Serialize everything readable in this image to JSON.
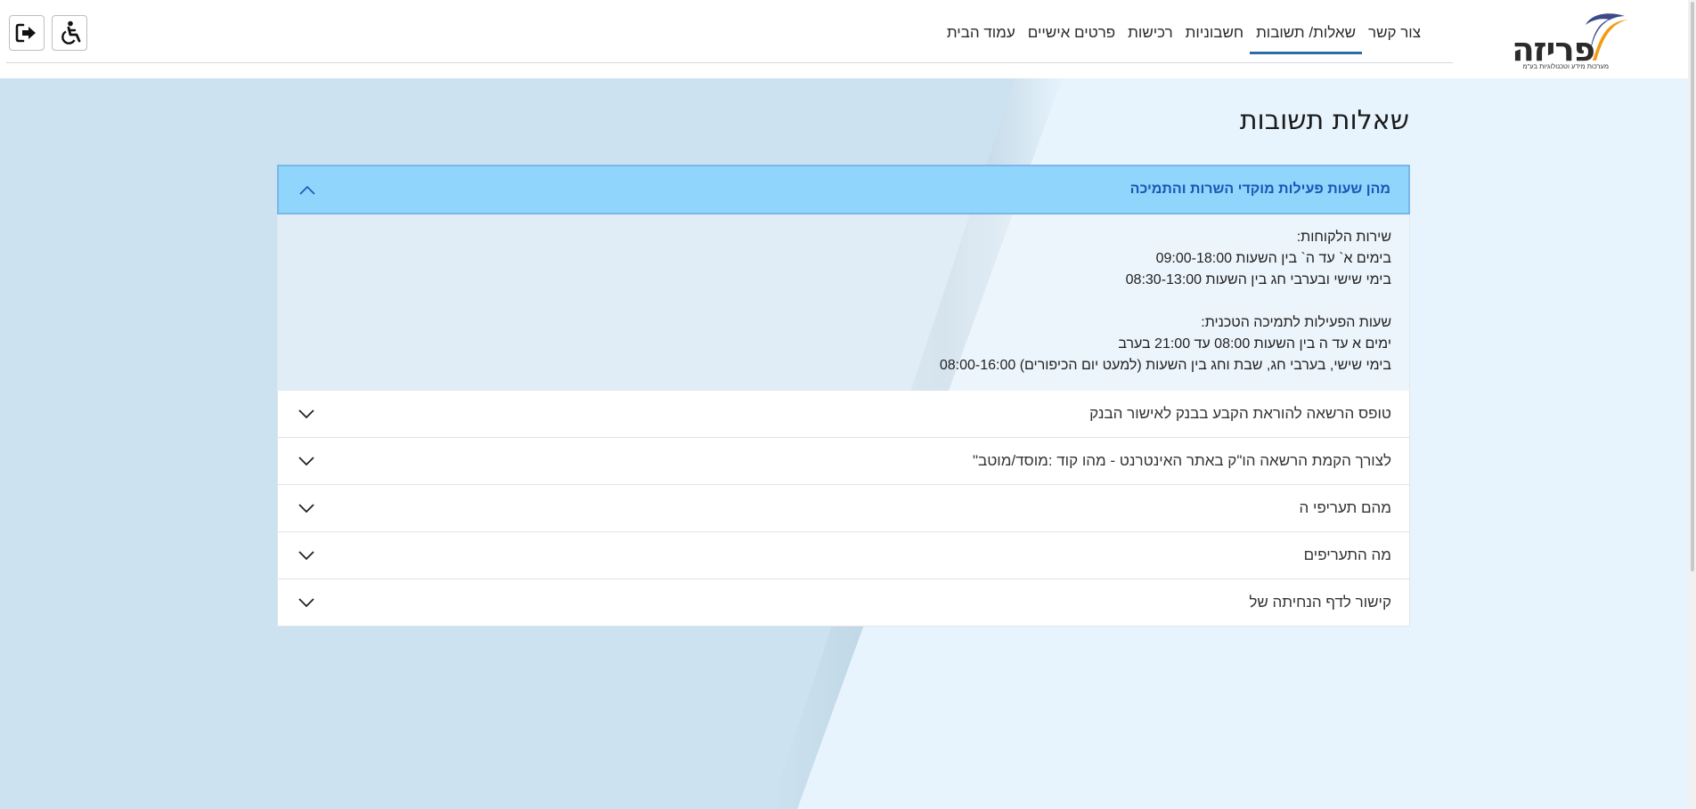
{
  "brand": {
    "name": "פריזה",
    "subtitle": "מערכות מידע וטכנולוגיות בע\"מ",
    "colors": {
      "orange": "#f39c12",
      "navy": "#3d4a8a"
    }
  },
  "header": {
    "nav": [
      {
        "label": "עמוד הבית",
        "active": false
      },
      {
        "label": "פרטים אישיים",
        "active": false
      },
      {
        "label": "רכישות",
        "active": false
      },
      {
        "label": "חשבוניות",
        "active": false
      },
      {
        "label": "שאלות/ תשובות",
        "active": true
      },
      {
        "label": "צור קשר",
        "active": false
      }
    ],
    "buttons": {
      "accessibility_icon": "wheelchair-icon",
      "logout_icon": "logout-icon"
    }
  },
  "page": {
    "title": "שאלות תשובות"
  },
  "faq": {
    "open_item": {
      "question": "מהן שעות פעילות מוקדי השרות והתמיכה",
      "answer_lines": [
        "שירות הלקוחות:",
        "בימים א` עד ה` בין השעות 09:00-18:00",
        "בימי שישי ובערבי חג בין השעות 08:30-13:00",
        "",
        "שעות הפעילות לתמיכה הטכנית:",
        "ימים א עד ה בין השעות 08:00 עד 21:00 בערב",
        "בימי שישי, בערבי חג, שבת וחג בין השעות (למעט יום הכיפורים) 08:00-16:00"
      ]
    },
    "items": [
      {
        "question": "טופס הרשאה להוראת הקבע בבנק לאישור הבנק"
      },
      {
        "question": "לצורך הקמת הרשאה הו\"ק באתר האינטרנט - מהו קוד :מוסד/מוטב\""
      },
      {
        "question": "מהם תעריפי ה"
      },
      {
        "question": "מה התעריפים"
      },
      {
        "question": "קישור לדף הנחיתה של"
      }
    ]
  },
  "colors": {
    "accent": "#2e6da4",
    "open_header_bg": "#8fd5fc",
    "open_header_text": "#1a56b5",
    "page_bg_light": "#e8f4fd",
    "page_bg_dark": "#cce2f0"
  }
}
